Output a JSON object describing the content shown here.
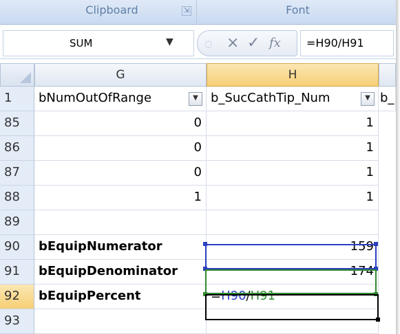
{
  "ribbon": {
    "clipboard_label": "Clipboard",
    "launcher_glyph": "⇲",
    "font_label": "Font"
  },
  "formula_bar": {
    "name_box": "SUM",
    "cancel_glyph": "×",
    "enter_glyph": "✓",
    "fx_glyph": "fx",
    "formula": "=H90/H91"
  },
  "grid": {
    "columns": [
      {
        "letter": "G"
      },
      {
        "letter": "H",
        "active": true
      }
    ],
    "header_row": {
      "row_number": "1",
      "g": "bNumOutOfRange",
      "h": "b_SucCathTip_Num",
      "next_partial": "b_"
    },
    "rows": [
      {
        "n": "85",
        "g": "0",
        "h": "1"
      },
      {
        "n": "86",
        "g": "0",
        "h": "1"
      },
      {
        "n": "87",
        "g": "0",
        "h": "1"
      },
      {
        "n": "88",
        "g": "1",
        "h": "1"
      },
      {
        "n": "89",
        "g": "",
        "h": ""
      },
      {
        "n": "90",
        "g": "bEquipNumerator",
        "h": "159"
      },
      {
        "n": "91",
        "g": "bEquipDenominator",
        "h": "174"
      },
      {
        "n": "92",
        "g": "bEquipPercent",
        "h": ""
      },
      {
        "n": "93",
        "g": "",
        "h": ""
      }
    ],
    "edit_cell": {
      "prefix": "=",
      "ref1": "H90",
      "op": "/",
      "ref2": "H91"
    }
  },
  "colors": {
    "ref1": "#2b3fbf",
    "ref2": "#2f8a2f",
    "active_header": "#f7cf75"
  },
  "icons": {
    "filter": "dropdown-arrow-icon",
    "name_box_dropdown": "chevron-down-icon"
  }
}
